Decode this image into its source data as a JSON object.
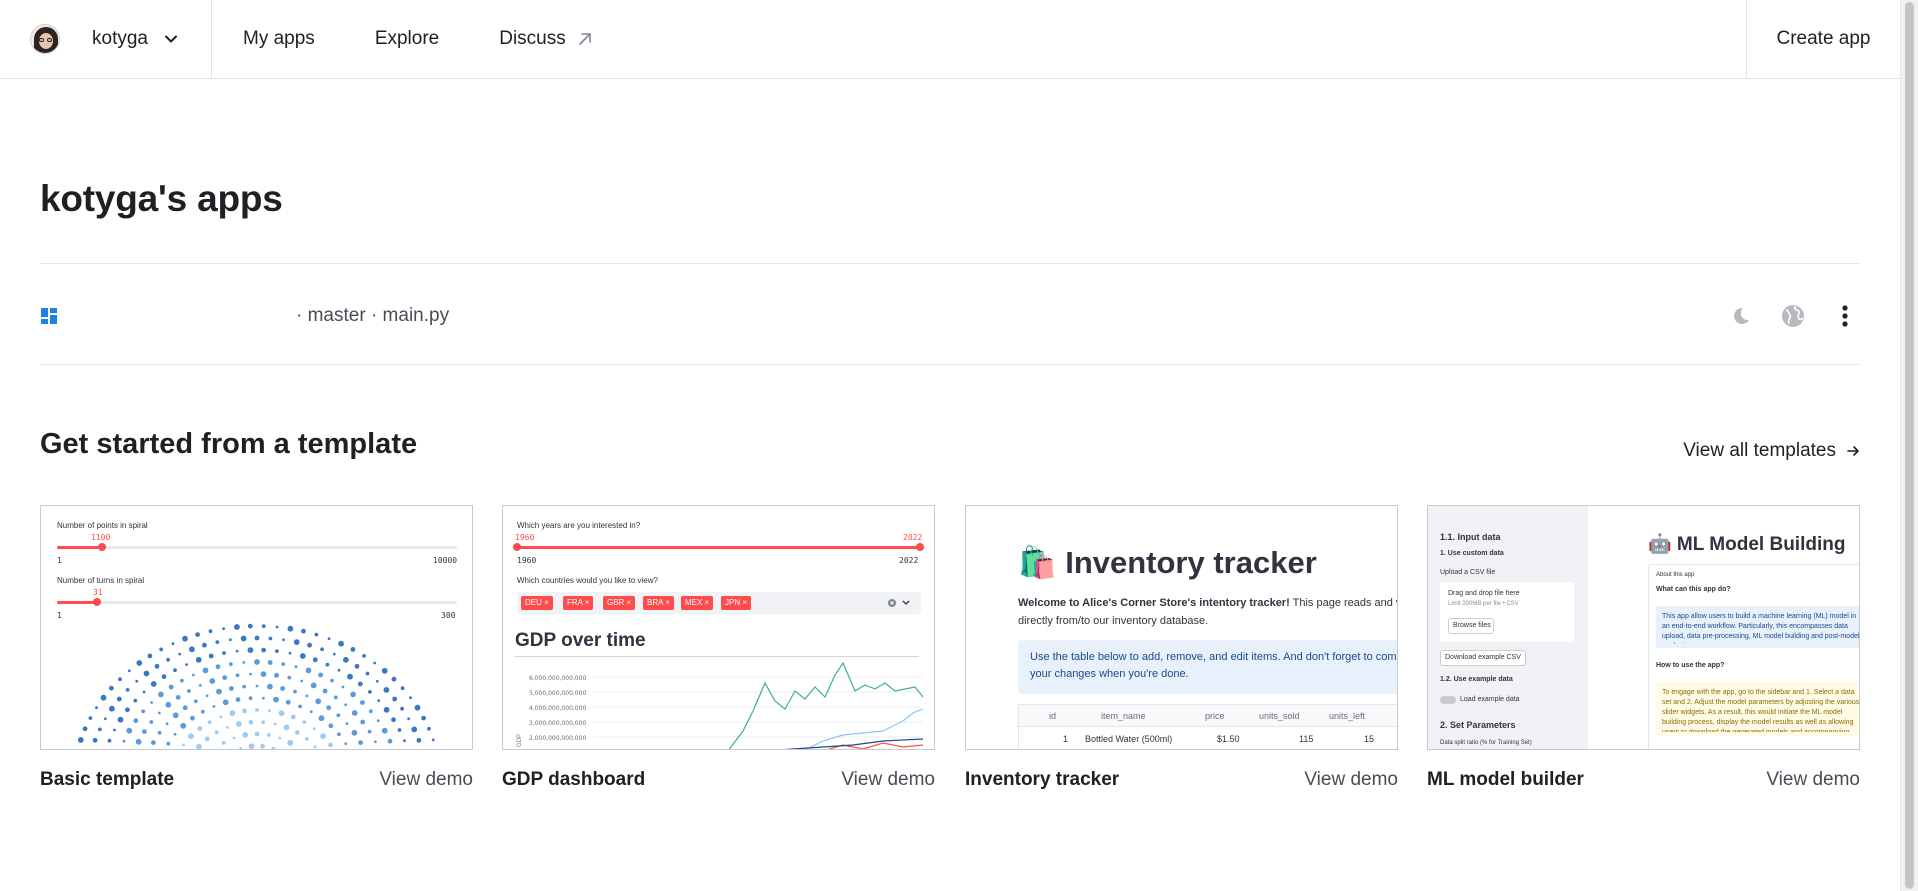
{
  "nav": {
    "username": "kotyga",
    "links": [
      "My apps",
      "Explore",
      "Discuss"
    ],
    "create": "Create app"
  },
  "page": {
    "title": "kotyga's apps"
  },
  "app": {
    "meta": "· master · main.py"
  },
  "templates": {
    "heading": "Get started from a template",
    "view_all": "View all templates",
    "cards": [
      {
        "name": "Basic template",
        "demo": "View demo"
      },
      {
        "name": "GDP dashboard",
        "demo": "View demo"
      },
      {
        "name": "Inventory tracker",
        "demo": "View demo"
      },
      {
        "name": "ML model builder",
        "demo": "View demo"
      }
    ]
  },
  "thumb_basic": {
    "label1": "Number of points in spiral",
    "val1": "1100",
    "min1": "1",
    "max1": "10000",
    "label2": "Number of turns in spiral",
    "val2": "31",
    "min2": "1",
    "max2": "300"
  },
  "thumb_gdp": {
    "q1": "Which years are you interested in?",
    "from": "1960",
    "to": "2022",
    "q2": "Which countries would you like to view?",
    "tags": [
      "DEU ×",
      "FRA ×",
      "GBR ×",
      "BRA ×",
      "MEX ×",
      "JPN ×"
    ],
    "title": "GDP over time",
    "yticks": [
      "6,000,000,000,000",
      "5,000,000,000,000",
      "4,000,000,000,000",
      "3,000,000,000,000",
      "2,000,000,000,000"
    ],
    "yaxis": "GDP"
  },
  "thumb_inv": {
    "title": "🛍️ Inventory tracker",
    "intro_bold": "Welcome to Alice's Corner Store's intentory tracker!",
    "intro_rest": " This page reads and writes directly from/to our inventory database.",
    "info": "Use the table below to add, remove, and edit items. And don't forget to commit your changes when you're done.",
    "cols": [
      "id",
      "item_name",
      "price",
      "units_sold",
      "units_left"
    ],
    "row": [
      "1",
      "Bottled Water (500ml)",
      "$1.50",
      "115",
      "15"
    ]
  },
  "thumb_ml": {
    "title": "🤖 ML Model Building",
    "s1": "1.1. Input data",
    "s2": "1. Use custom data",
    "s3": "Upload a CSV file",
    "s4": "Drag and drop file here",
    "s5": "Limit 200MB per file • CSV",
    "s6": "Browse files",
    "s7": "Download example CSV",
    "s8": "1.2. Use example data",
    "s9": "Load example data",
    "s10": "2. Set Parameters",
    "s11": "Data split ratio (% for Training Set)",
    "m1": "About this app",
    "m2": "What can this app do?",
    "m3": "This app allow users to build a machine learning (ML) model in an end-to-end workflow. Particularly, this encompasses data upload, data pre-processing, ML model building and post-model analysis.",
    "m4": "How to use the app?",
    "m5": "To engage with the app, go to the sidebar and 1. Select a data set and 2. Adjust the model parameters by adjusting the various slider widgets. As a result, this would initiate the ML model building process, display the model results as well as allowing users to download the generated models and accompanying data."
  }
}
